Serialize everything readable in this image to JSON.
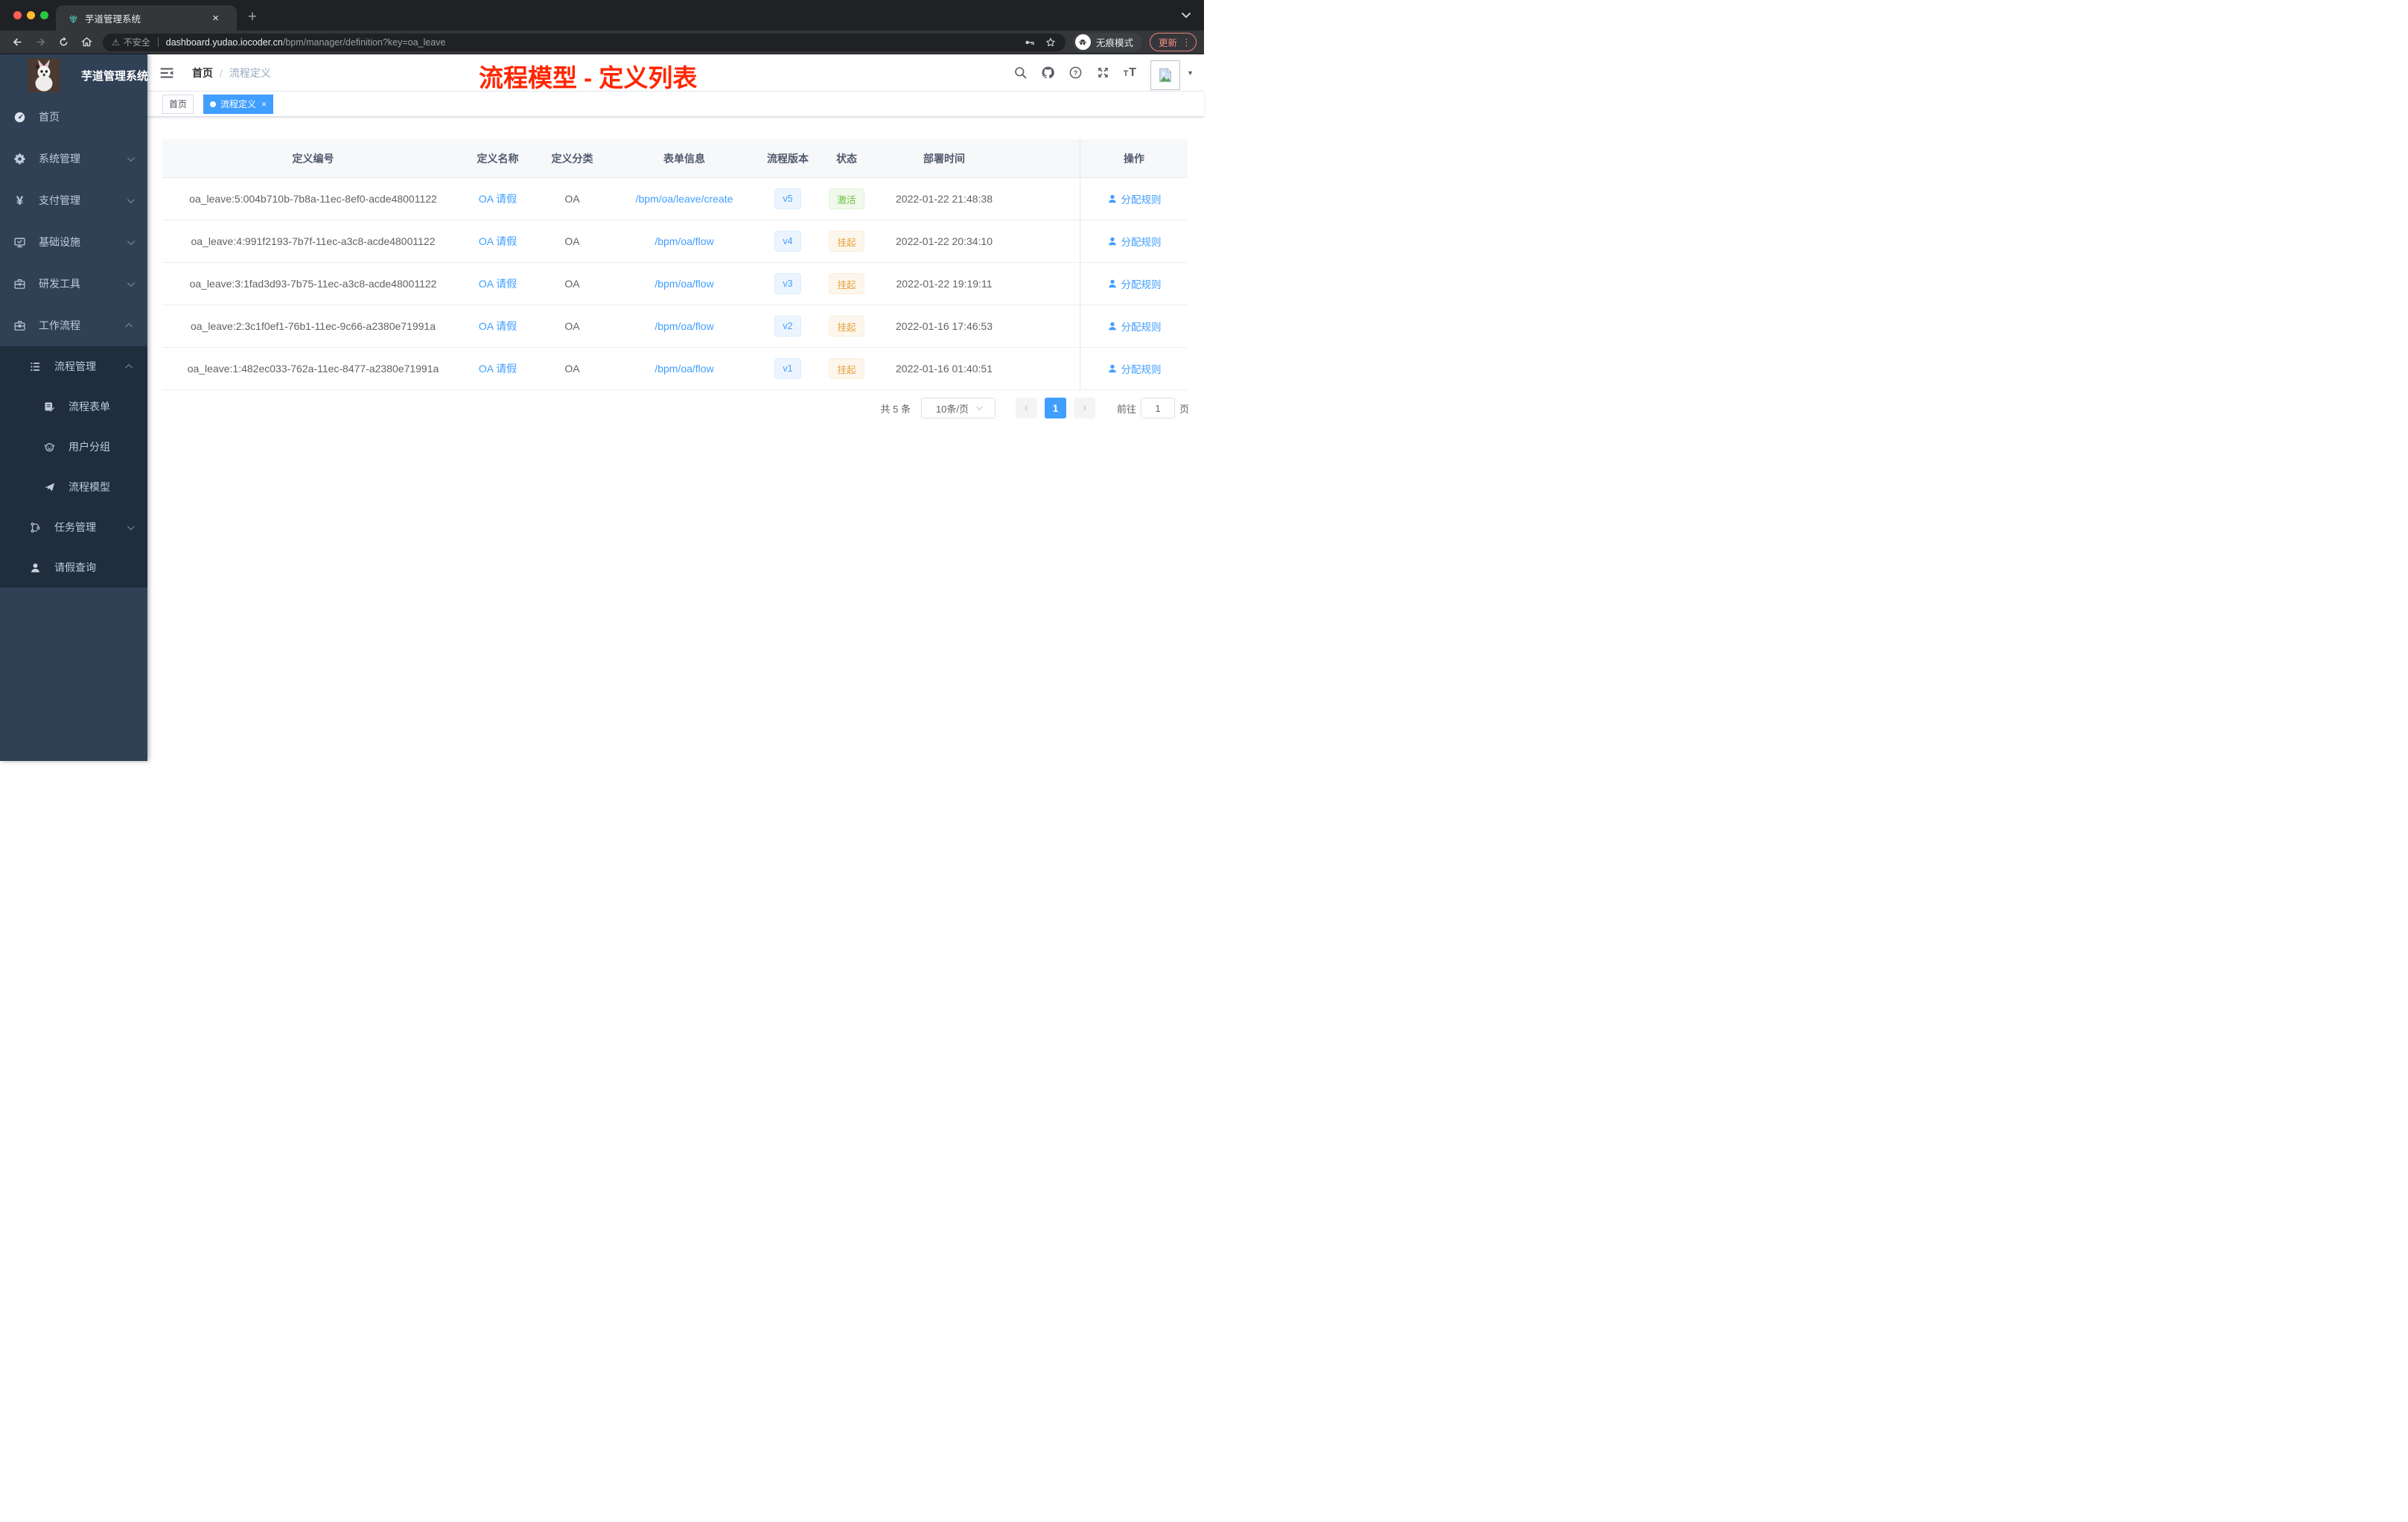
{
  "browser": {
    "tab_title": "芋道管理系统",
    "url": {
      "warning_text": "不安全",
      "host": "dashboard.yudao.iocoder.cn",
      "path": "/bpm/manager/definition?key=oa_leave"
    },
    "incognito_label": "无痕模式",
    "update_label": "更新"
  },
  "icons": {
    "close": "×",
    "plus": "+",
    "warning": "⚠",
    "more": "⋮",
    "caret": "▼",
    "prev": "‹",
    "next": "›"
  },
  "sidebar": {
    "logo_title": "芋道管理系统",
    "items": [
      {
        "label": "首页"
      },
      {
        "label": "系统管理"
      },
      {
        "label": "支付管理"
      },
      {
        "label": "基础设施"
      },
      {
        "label": "研发工具"
      },
      {
        "label": "工作流程"
      },
      {
        "label": "流程管理"
      },
      {
        "label": "流程表单"
      },
      {
        "label": "用户分组"
      },
      {
        "label": "流程模型"
      },
      {
        "label": "任务管理"
      },
      {
        "label": "请假查询"
      }
    ],
    "yen_icon": "¥"
  },
  "header": {
    "breadcrumb": [
      "首页",
      "流程定义"
    ],
    "breadcrumb_sep": "/",
    "annotation": "流程模型 - 定义列表"
  },
  "tags": {
    "items": [
      {
        "label": "首页"
      },
      {
        "label": "流程定义",
        "active": true
      }
    ]
  },
  "table": {
    "columns": [
      "定义编号",
      "定义名称",
      "定义分类",
      "表单信息",
      "流程版本",
      "状态",
      "部署时间",
      "操作"
    ],
    "rows": [
      {
        "id": "oa_leave:5:004b710b-7b8a-11ec-8ef0-acde48001122",
        "name": "OA 请假",
        "category": "OA",
        "form": "/bpm/oa/leave/create",
        "version": "v5",
        "status": "激活",
        "status_type": "success",
        "time": "2022-01-22 21:48:38",
        "action": "分配规则"
      },
      {
        "id": "oa_leave:4:991f2193-7b7f-11ec-a3c8-acde48001122",
        "name": "OA 请假",
        "category": "OA",
        "form": "/bpm/oa/flow",
        "version": "v4",
        "status": "挂起",
        "status_type": "warning",
        "time": "2022-01-22 20:34:10",
        "action": "分配规则"
      },
      {
        "id": "oa_leave:3:1fad3d93-7b75-11ec-a3c8-acde48001122",
        "name": "OA 请假",
        "category": "OA",
        "form": "/bpm/oa/flow",
        "version": "v3",
        "status": "挂起",
        "status_type": "warning",
        "time": "2022-01-22 19:19:11",
        "action": "分配规则"
      },
      {
        "id": "oa_leave:2:3c1f0ef1-76b1-11ec-9c66-a2380e71991a",
        "name": "OA 请假",
        "category": "OA",
        "form": "/bpm/oa/flow",
        "version": "v2",
        "status": "挂起",
        "status_type": "warning",
        "time": "2022-01-16 17:46:53",
        "action": "分配规则"
      },
      {
        "id": "oa_leave:1:482ec033-762a-11ec-8477-a2380e71991a",
        "name": "OA 请假",
        "category": "OA",
        "form": "/bpm/oa/flow",
        "version": "v1",
        "status": "挂起",
        "status_type": "warning",
        "time": "2022-01-16 01:40:51",
        "action": "分配规则"
      }
    ]
  },
  "pagination": {
    "total": "共 5 条",
    "page_size": "10条/页",
    "current_page": "1",
    "goto_label": "前往",
    "goto_value": "1",
    "page_unit": "页"
  },
  "colors": {
    "accent": "#409eff",
    "success": "#67c23a",
    "warning": "#e6a23c",
    "annotation_red": "#ff2600",
    "sidebar_bg": "#304156",
    "submenu_bg": "#1f2d3d"
  }
}
